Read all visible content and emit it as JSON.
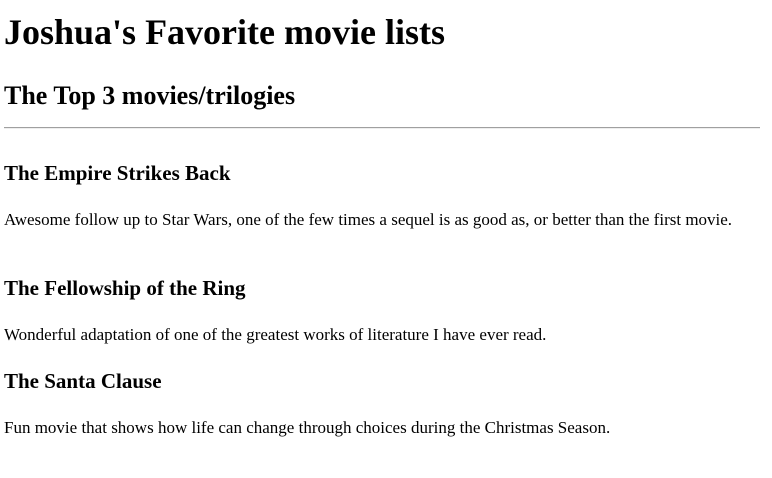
{
  "page": {
    "title": "Joshua's Favorite movie lists",
    "subtitle": "The Top 3 movies/trilogies"
  },
  "movies": [
    {
      "title": "The Empire Strikes Back",
      "description": "Awesome follow up to Star Wars, one of the few times a sequel is as good as, or better than the first movie."
    },
    {
      "title": "The Fellowship of the Ring",
      "description": "Wonderful adaptation of one of the greatest works of literature I have ever read."
    },
    {
      "title": "The Santa Clause",
      "description": "Fun movie that shows how life can change through choices during the Christmas Season."
    }
  ]
}
